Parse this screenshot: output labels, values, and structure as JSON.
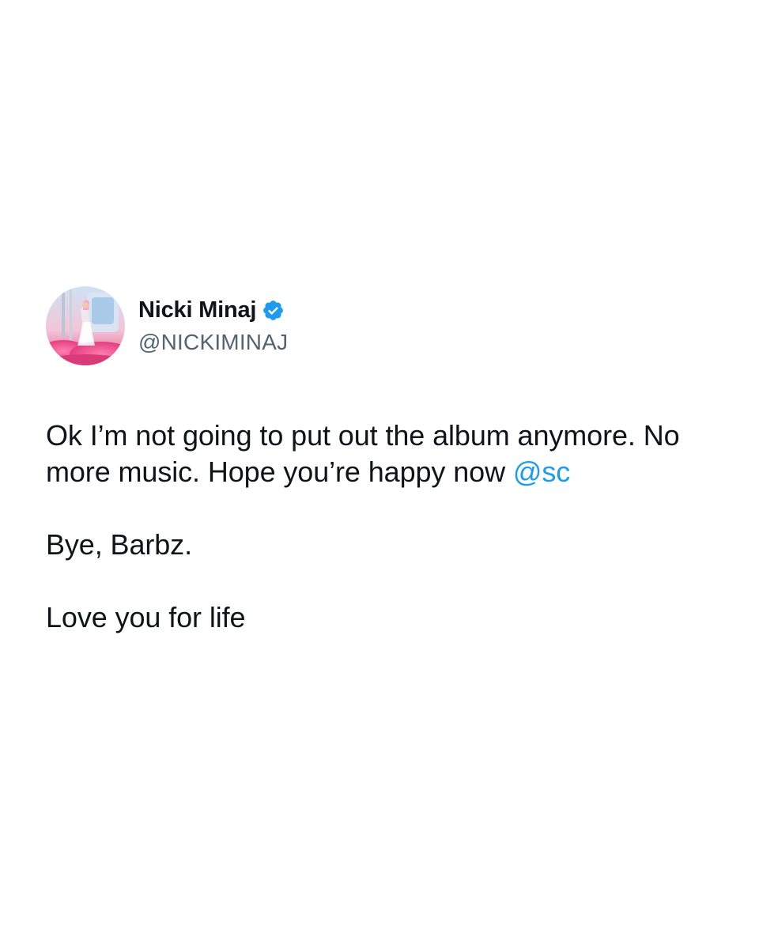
{
  "author": {
    "display_name": "Nicki Minaj",
    "handle": "@NICKIMINAJ",
    "verified_icon": "verified-badge-icon",
    "avatar": "profile-photo-pink-scene"
  },
  "tweet": {
    "line1": "Ok I’m not going to put out the album anymore. No",
    "line2": "more music. Hope you’re happy now ",
    "mention": "@sc",
    "para2": "Bye, Barbz.",
    "para3": "Love you for life"
  },
  "colors": {
    "text": "#0f1419",
    "secondary": "#536471",
    "link": "#1d9bf0",
    "verified": "#1d9bf0",
    "background": "#ffffff"
  }
}
